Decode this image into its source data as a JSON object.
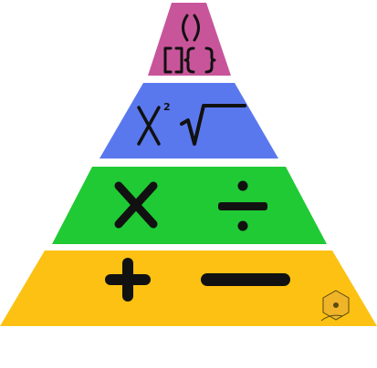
{
  "pyramid": {
    "levels": [
      {
        "id": "level-top",
        "color": "#c8559a",
        "symbols": [
          "()",
          "[]{}"
        ]
      },
      {
        "id": "level-second",
        "color": "#5a78ee",
        "symbols": [
          "x²",
          "√"
        ]
      },
      {
        "id": "level-third",
        "color": "#1fca34",
        "symbols": [
          "×",
          "÷"
        ]
      },
      {
        "id": "level-bottom",
        "color": "#fcc112",
        "symbols": [
          "+",
          "−"
        ]
      }
    ],
    "badge": {
      "color": "#f0b429"
    }
  }
}
